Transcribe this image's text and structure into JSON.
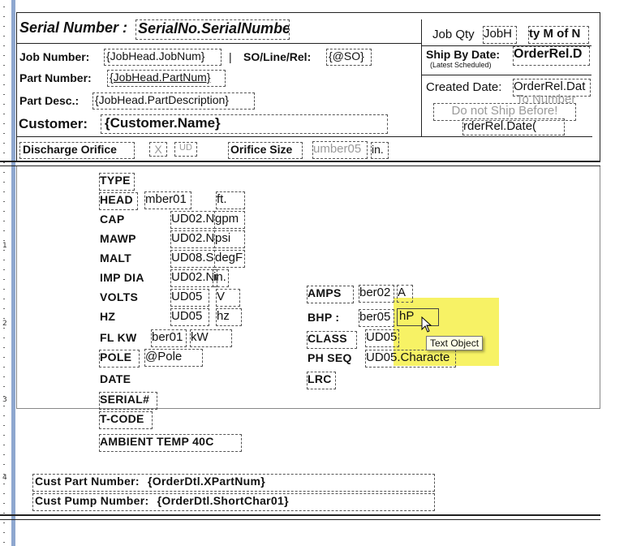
{
  "ruler": {
    "numbers": [
      "1",
      "2",
      "3",
      "4"
    ]
  },
  "header": {
    "serial_label": "Serial Number :",
    "serial_value": "SerialNo.SerialNumbe",
    "job_qty_label": "Job Qty",
    "job_qty_value": "JobH",
    "qty_of_label": "ty M of N",
    "job_number_label": "Job Number:",
    "job_number_value": "{JobHead.JobNum}",
    "separator": "|",
    "so_label": "SO/Line/Rel:",
    "so_value": "{@SO}",
    "part_number_label": "Part Number:",
    "part_number_value": "{JobHead.PartNum}",
    "part_desc_label": "Part Desc.:",
    "part_desc_value": "{JobHead.PartDescription}",
    "customer_label": "Customer:",
    "customer_value": "{Customer.Name}",
    "ship_by_label": "Ship By Date:",
    "ship_by_sub": "(Latest Scheduled)",
    "ship_by_value": "OrderRel.D",
    "created_label": "Created Date:",
    "created_value": "OrderRel.Dat",
    "to_number": "To Number",
    "do_not_ship": "Do not Ship Before!",
    "do_not_ship_value": "rderRel.Date("
  },
  "discharge": {
    "label": "Discharge Orifice",
    "x_value": "X",
    "ud_value": "UD",
    "size_label": "Orifice Size",
    "size_value": "umber05",
    "size_unit": "in."
  },
  "specs_left": [
    {
      "label": "TYPE",
      "value": "",
      "unit": ""
    },
    {
      "label": "HEAD",
      "value": "mber01",
      "unit": "ft."
    },
    {
      "label": "CAP",
      "value": "UD02.N",
      "unit": "gpm"
    },
    {
      "label": "MAWP",
      "value": "UD02.N",
      "unit": "psi"
    },
    {
      "label": "MALT",
      "value": "UD08.S",
      "unit": "degF"
    },
    {
      "label": "IMP DIA",
      "value": "UD02.Nu",
      "unit": "in."
    },
    {
      "label": "VOLTS",
      "value": "UD05",
      "unit": "V"
    },
    {
      "label": "HZ",
      "value": "UD05",
      "unit": "hz"
    },
    {
      "label": "FL KW",
      "value": "ber01",
      "unit": "kW"
    },
    {
      "label": "POLE",
      "value": "@Pole",
      "unit": ""
    },
    {
      "label": "DATE",
      "value": "",
      "unit": ""
    },
    {
      "label": "SERIAL#",
      "value": "",
      "unit": ""
    },
    {
      "label": "T-CODE",
      "value": "",
      "unit": ""
    },
    {
      "label": "AMBIENT TEMP 40C",
      "value": "",
      "unit": ""
    }
  ],
  "specs_right": [
    {
      "label": "AMPS",
      "value": "ber02",
      "unit": "A"
    },
    {
      "label": "BHP :",
      "value": "ber05",
      "unit": "hP"
    },
    {
      "label": "CLASS",
      "value": "UD05",
      "unit": ""
    },
    {
      "label": "PH SEQ",
      "value": "UD05.Characte",
      "unit": ""
    },
    {
      "label": "LRC",
      "value": "",
      "unit": ""
    }
  ],
  "footer": {
    "cust_part_label": "Cust Part Number:",
    "cust_part_value": "{OrderDtl.XPartNum}",
    "cust_pump_label": "Cust Pump Number:",
    "cust_pump_value": "{OrderDtl.ShortChar01}"
  },
  "tooltip": {
    "text": "Text Object"
  },
  "colors": {
    "highlight": "#f6f04a",
    "ruler_bar": "#8ea7cf"
  }
}
